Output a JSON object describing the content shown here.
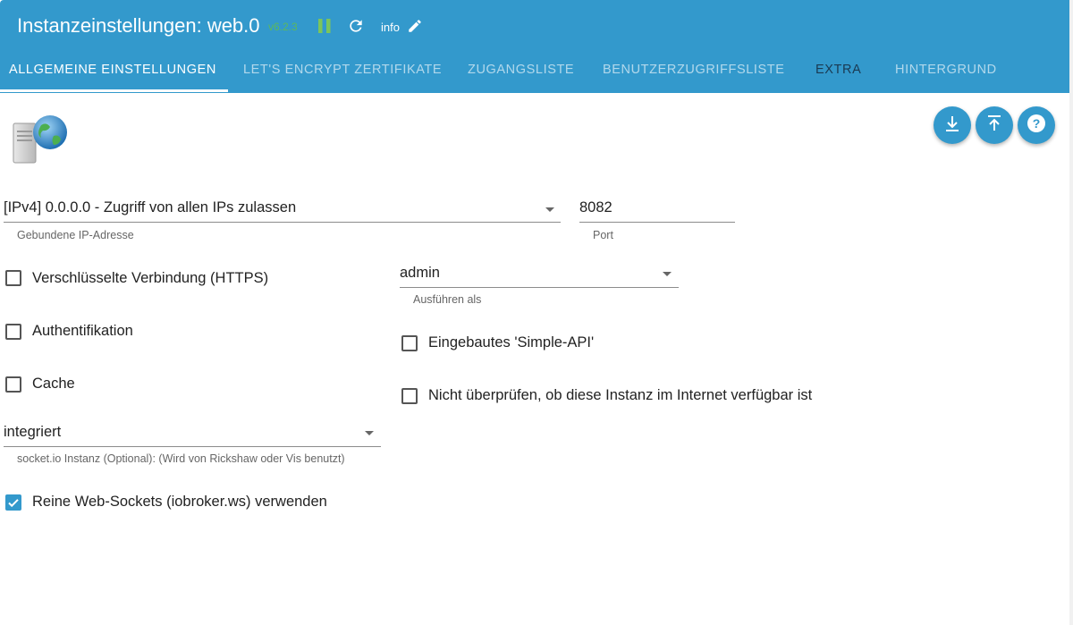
{
  "header": {
    "title": "Instanzeinstellungen: web.0",
    "version": "v6.2.3",
    "info_label": "info"
  },
  "tabs": [
    {
      "label": "ALLGEMEINE EINSTELLUNGEN",
      "active": true
    },
    {
      "label": "LET'S ENCRYPT ZERTIFIKATE",
      "active": false
    },
    {
      "label": "ZUGANGSLISTE",
      "active": false
    },
    {
      "label": "BENUTZERZUGRIFFSLISTE",
      "active": false
    },
    {
      "label": "EXTRA",
      "active": false
    },
    {
      "label": "HINTERGRUND",
      "active": false
    }
  ],
  "form": {
    "bind_ip": {
      "value": "[IPv4] 0.0.0.0 - Zugriff von allen IPs zulassen",
      "helper": "Gebundene IP-Adresse"
    },
    "port": {
      "value": "8082",
      "helper": "Port"
    },
    "run_as": {
      "value": "admin",
      "helper": "Ausführen als"
    },
    "socketio": {
      "value": "integriert",
      "helper": "socket.io Instanz (Optional): (Wird von Rickshaw oder Vis benutzt)"
    },
    "checkboxes": {
      "https": {
        "label": "Verschlüsselte Verbindung (HTTPS)",
        "checked": false
      },
      "auth": {
        "label": "Authentifikation",
        "checked": false
      },
      "cache": {
        "label": "Cache",
        "checked": false
      },
      "simple_api": {
        "label": "Eingebautes 'Simple-API'",
        "checked": false
      },
      "no_check": {
        "label": "Nicht überprüfen, ob diese Instanz im Internet verfügbar ist",
        "checked": false
      },
      "pure_ws": {
        "label": "Reine Web-Sockets (iobroker.ws) verwenden",
        "checked": true
      }
    }
  },
  "icons": {
    "title_bar": [
      "pause-icon",
      "reload-icon",
      "edit-icon"
    ],
    "fabs": [
      "download-icon",
      "upload-icon",
      "help-icon"
    ],
    "logo": "server-globe-icon"
  },
  "colors": {
    "primary": "#3399cc",
    "version": "#5cb85c",
    "pause": "#7cc55a"
  }
}
